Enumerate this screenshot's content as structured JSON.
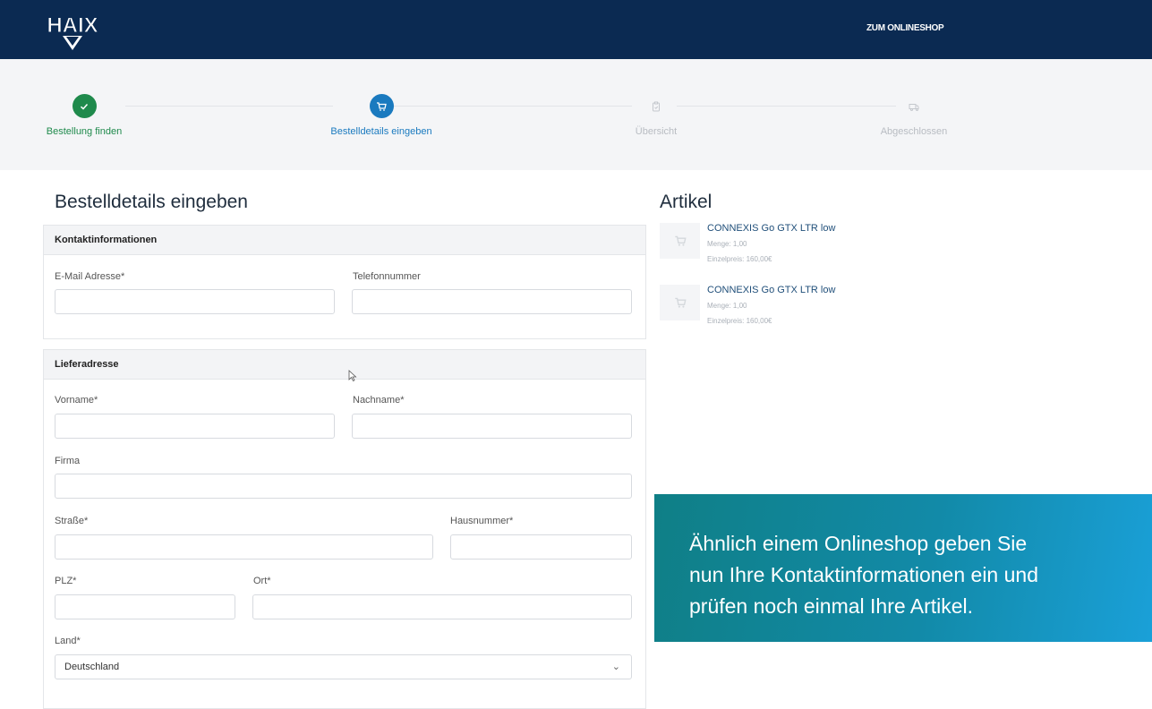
{
  "header": {
    "logo_text": "HAIX",
    "shop_link": "ZUM ONLINESHOP",
    "bg_color": "#0b2a52"
  },
  "steps": [
    {
      "label": "Bestellung finden",
      "state": "done",
      "icon": "check-icon"
    },
    {
      "label": "Bestelldetails eingeben",
      "state": "active",
      "icon": "cart-icon"
    },
    {
      "label": "Übersicht",
      "state": "pending",
      "icon": "clipboard-icon"
    },
    {
      "label": "Abgeschlossen",
      "state": "pending",
      "icon": "truck-icon"
    }
  ],
  "form": {
    "title": "Bestelldetails eingeben",
    "contact": {
      "heading": "Kontaktinformationen",
      "email_label": "E-Mail Adresse*",
      "phone_label": "Telefonnummer"
    },
    "delivery": {
      "heading": "Lieferadresse",
      "firstname_label": "Vorname*",
      "lastname_label": "Nachname*",
      "company_label": "Firma",
      "street_label": "Straße*",
      "housenumber_label": "Hausnummer*",
      "zip_label": "PLZ*",
      "city_label": "Ort*",
      "country_label": "Land*",
      "country_value": "Deutschland"
    }
  },
  "articles": {
    "title": "Artikel",
    "items": [
      {
        "name": "CONNEXIS Go GTX LTR low",
        "quantity": "Menge: 1,00",
        "unit_price": "Einzelpreis: 160,00€"
      },
      {
        "name": "CONNEXIS Go GTX LTR low",
        "quantity": "Menge: 1,00",
        "unit_price": "Einzelpreis: 160,00€"
      }
    ]
  },
  "overlay": {
    "lines": [
      "Ähnlich einem Onlineshop geben Sie",
      "nun Ihre Kontaktinformationen ein und",
      "prüfen noch einmal Ihre Artikel."
    ]
  },
  "colors": {
    "done": "#1f8a4c",
    "active": "#1a7abf",
    "pending": "#b8bcc2",
    "overlay": "#128aa8"
  }
}
